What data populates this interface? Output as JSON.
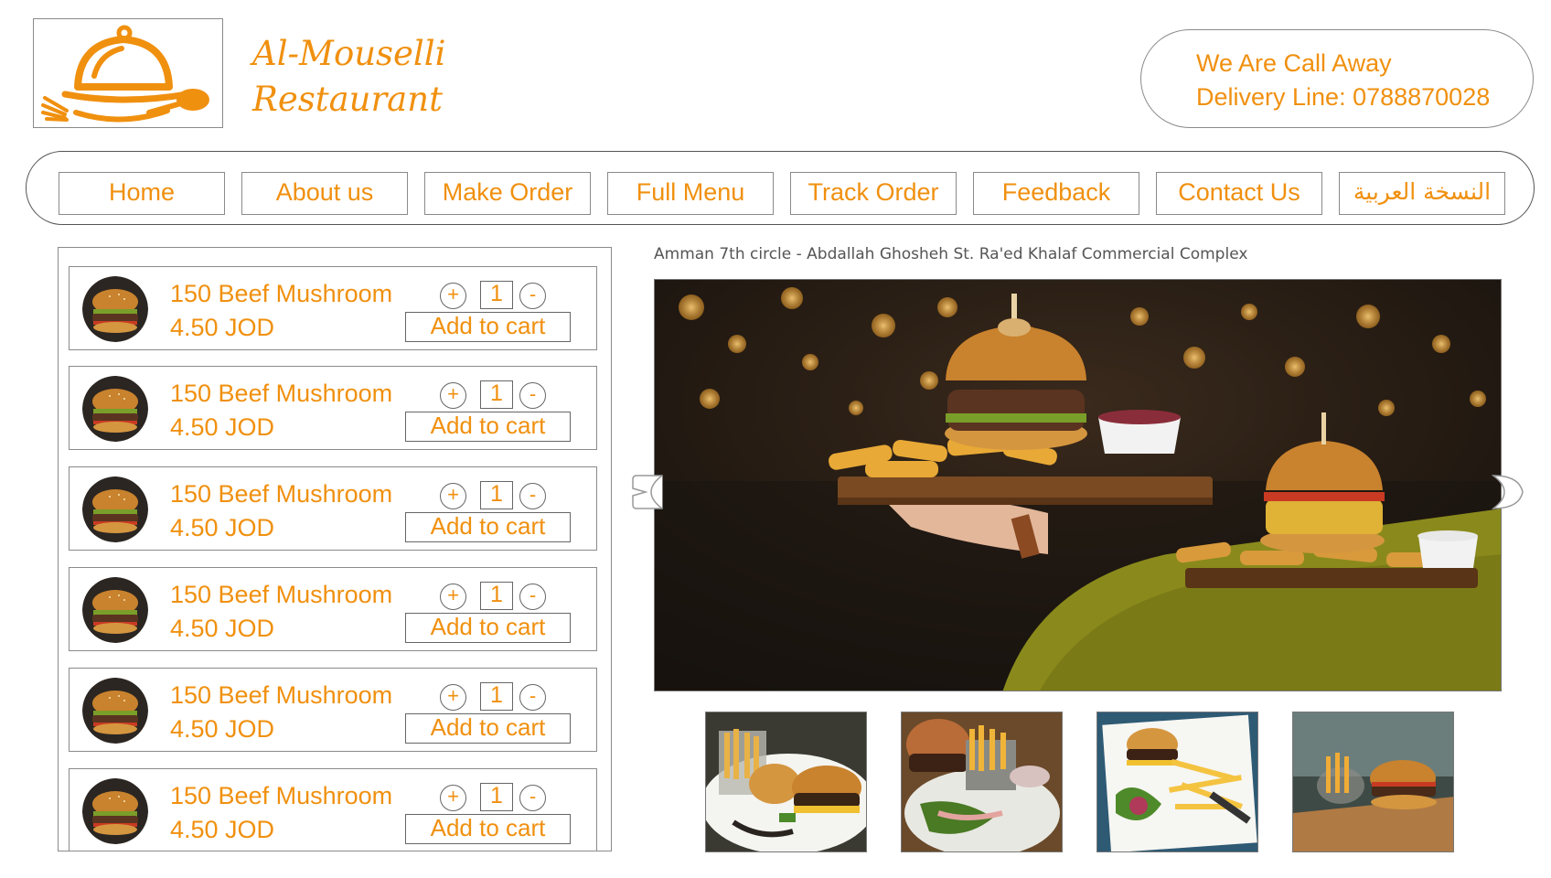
{
  "brand": {
    "name_line1": "Al-Mouselli",
    "name_line2": "Restaurant",
    "logo_icon": "cloche-fork-spoon-icon"
  },
  "contact": {
    "line1": "We Are Call Away",
    "line2": "Delivery Line: 0788870028"
  },
  "nav": {
    "items": [
      {
        "label": "Home"
      },
      {
        "label": "About us"
      },
      {
        "label": "Make Order"
      },
      {
        "label": "Full Menu"
      },
      {
        "label": "Track Order"
      },
      {
        "label": "Feedback"
      },
      {
        "label": "Contact Us"
      },
      {
        "label": "النسخة العربية"
      }
    ]
  },
  "menu": {
    "items": [
      {
        "name": "150 Beef Mushroom",
        "price": "4.50 JOD",
        "qty": "1",
        "plus": "+",
        "minus": "-",
        "cart_label": "Add to cart"
      },
      {
        "name": "150 Beef Mushroom",
        "price": "4.50 JOD",
        "qty": "1",
        "plus": "+",
        "minus": "-",
        "cart_label": "Add to cart"
      },
      {
        "name": "150 Beef Mushroom",
        "price": "4.50 JOD",
        "qty": "1",
        "plus": "+",
        "minus": "-",
        "cart_label": "Add to cart"
      },
      {
        "name": "150 Beef Mushroom",
        "price": "4.50 JOD",
        "qty": "1",
        "plus": "+",
        "minus": "-",
        "cart_label": "Add to cart"
      },
      {
        "name": "150 Beef Mushroom",
        "price": "4.50 JOD",
        "qty": "1",
        "plus": "+",
        "minus": "-",
        "cart_label": "Add to cart"
      },
      {
        "name": "150 Beef Mushroom",
        "price": "4.50 JOD",
        "qty": "1",
        "plus": "+",
        "minus": "-",
        "cart_label": "Add to cart"
      }
    ]
  },
  "gallery": {
    "address": "Amman 7th circle - Abdallah Ghosheh St. Ra'ed Khalaf Commercial Complex",
    "prev_icon": "chevron-left-icon",
    "next_icon": "chevron-right-icon"
  },
  "colors": {
    "accent": "#f0900f",
    "border": "#8a8a8a"
  }
}
